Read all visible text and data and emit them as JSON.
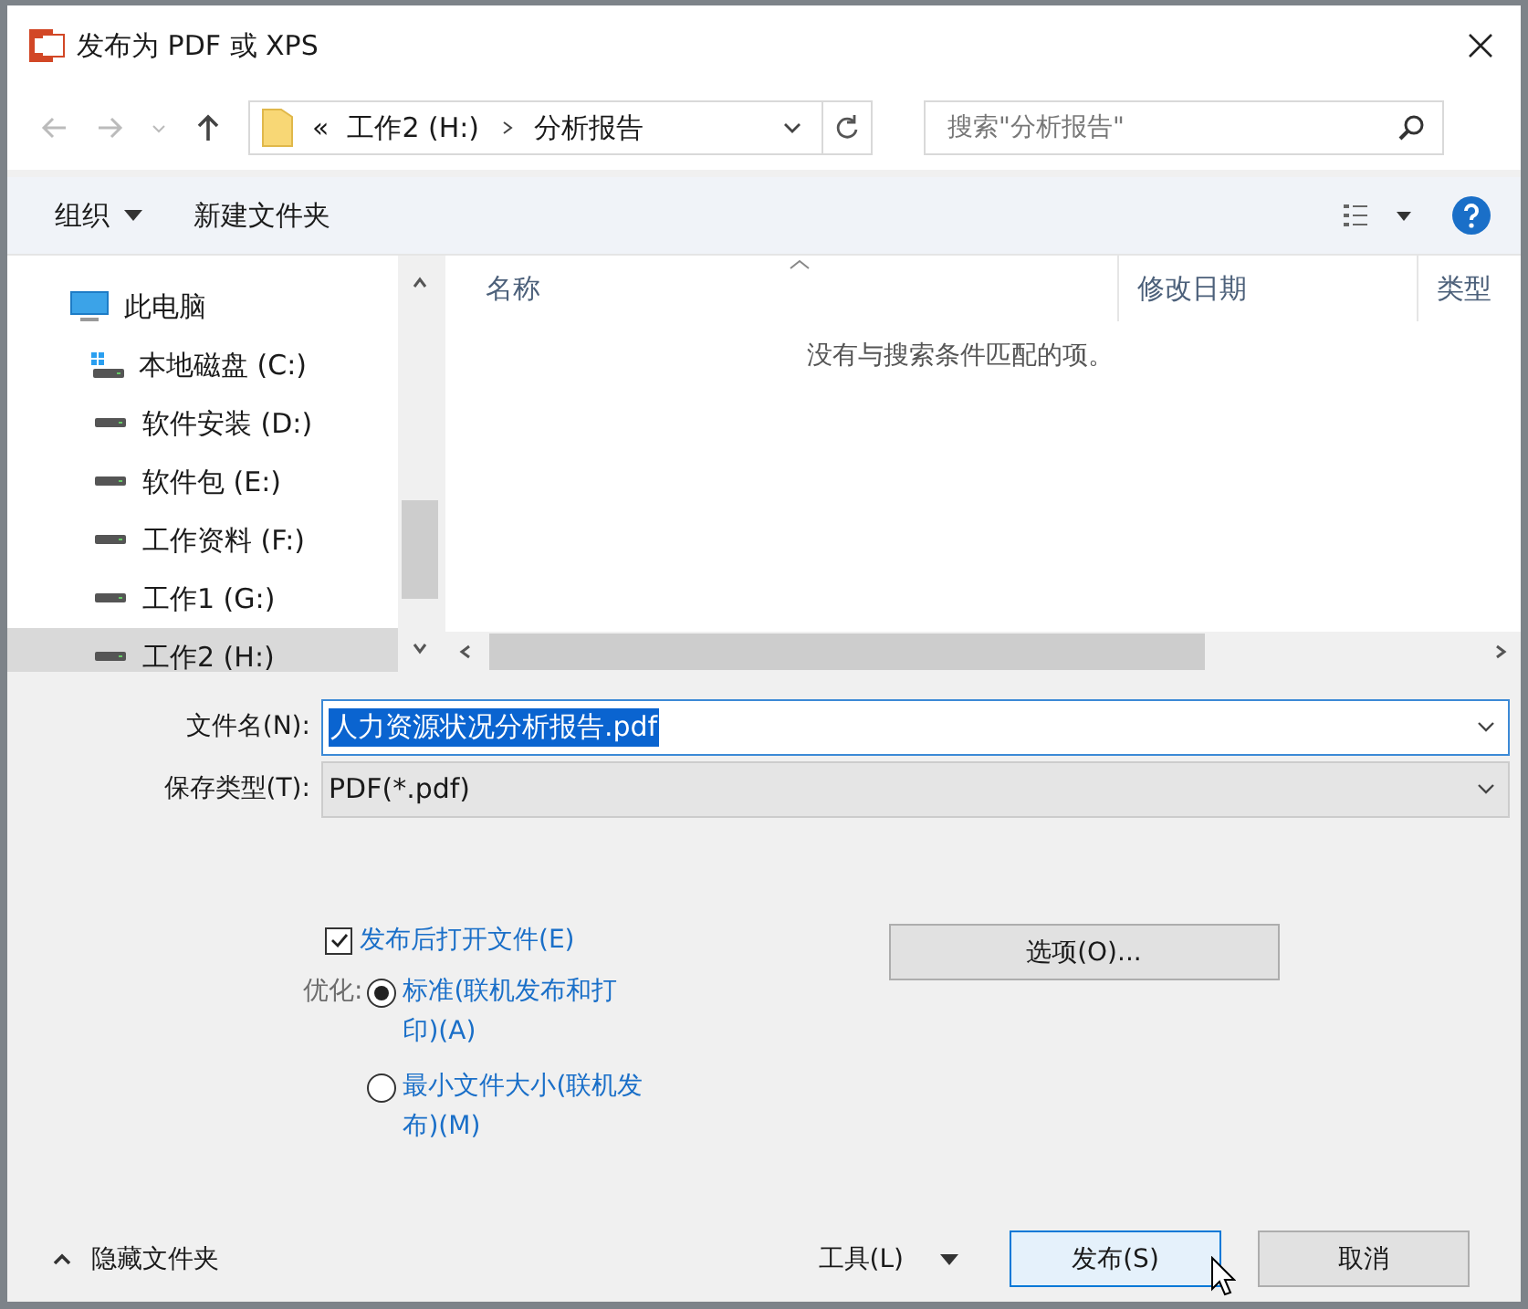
{
  "window": {
    "title": "发布为 PDF 或 XPS"
  },
  "nav": {
    "path_prefix": "«",
    "path": [
      "工作2 (H:)",
      "分析报告"
    ],
    "search_placeholder": "搜索\"分析报告\""
  },
  "toolbar": {
    "organize": "组织",
    "new_folder": "新建文件夹"
  },
  "sidebar": {
    "items": [
      {
        "label": "此电脑",
        "kind": "pc",
        "selected": false,
        "children": [
          {
            "label": "本地磁盘 (C:)",
            "kind": "system-drive",
            "selected": false
          },
          {
            "label": "软件安装 (D:)",
            "kind": "drive",
            "selected": false
          },
          {
            "label": "软件包 (E:)",
            "kind": "drive",
            "selected": false
          },
          {
            "label": "工作资料 (F:)",
            "kind": "drive",
            "selected": false
          },
          {
            "label": "工作1 (G:)",
            "kind": "drive",
            "selected": false
          },
          {
            "label": "工作2 (H:)",
            "kind": "drive",
            "selected": true
          }
        ]
      }
    ]
  },
  "file_list": {
    "columns": [
      "名称",
      "修改日期",
      "类型"
    ],
    "empty_message": "没有与搜索条件匹配的项。"
  },
  "file_name": {
    "label": "文件名(N):",
    "value": "人力资源状况分析报告.pdf"
  },
  "file_type": {
    "label": "保存类型(T):",
    "value": "PDF(*.pdf)"
  },
  "open_after": {
    "label": "发布后打开文件(E)",
    "checked": true
  },
  "optimize": {
    "label": "优化:",
    "options": [
      {
        "label": "标准(联机发布和打印)(A)",
        "selected": true
      },
      {
        "label": "最小文件大小(联机发布)(M)",
        "selected": false
      }
    ]
  },
  "options_button": "选项(O)...",
  "hide_folders": "隐藏文件夹",
  "tools": "工具(L)",
  "publish": "发布(S)",
  "cancel": "取消"
}
